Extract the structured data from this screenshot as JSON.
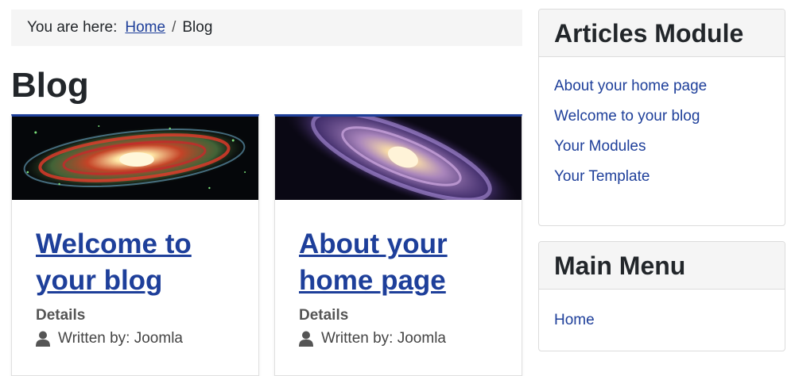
{
  "breadcrumb": {
    "prefix": "You are here:",
    "home": "Home",
    "separator": "/",
    "current": "Blog"
  },
  "page_title": "Blog",
  "articles": [
    {
      "title": "Welcome to your blog",
      "details_label": "Details",
      "author": "Written by: Joomla",
      "image": "galaxy-red-image"
    },
    {
      "title": "About your home page",
      "details_label": "Details",
      "author": "Written by: Joomla",
      "image": "galaxy-purple-image"
    }
  ],
  "articles_module": {
    "title": "Articles Module",
    "items": [
      "About your home page",
      "Welcome to your blog",
      "Your Modules",
      "Your Template"
    ]
  },
  "main_menu": {
    "title": "Main Menu",
    "items": [
      "Home"
    ]
  },
  "colors": {
    "link": "#1e3f9a",
    "text": "#22262a",
    "panel_bg": "#f5f5f5"
  }
}
